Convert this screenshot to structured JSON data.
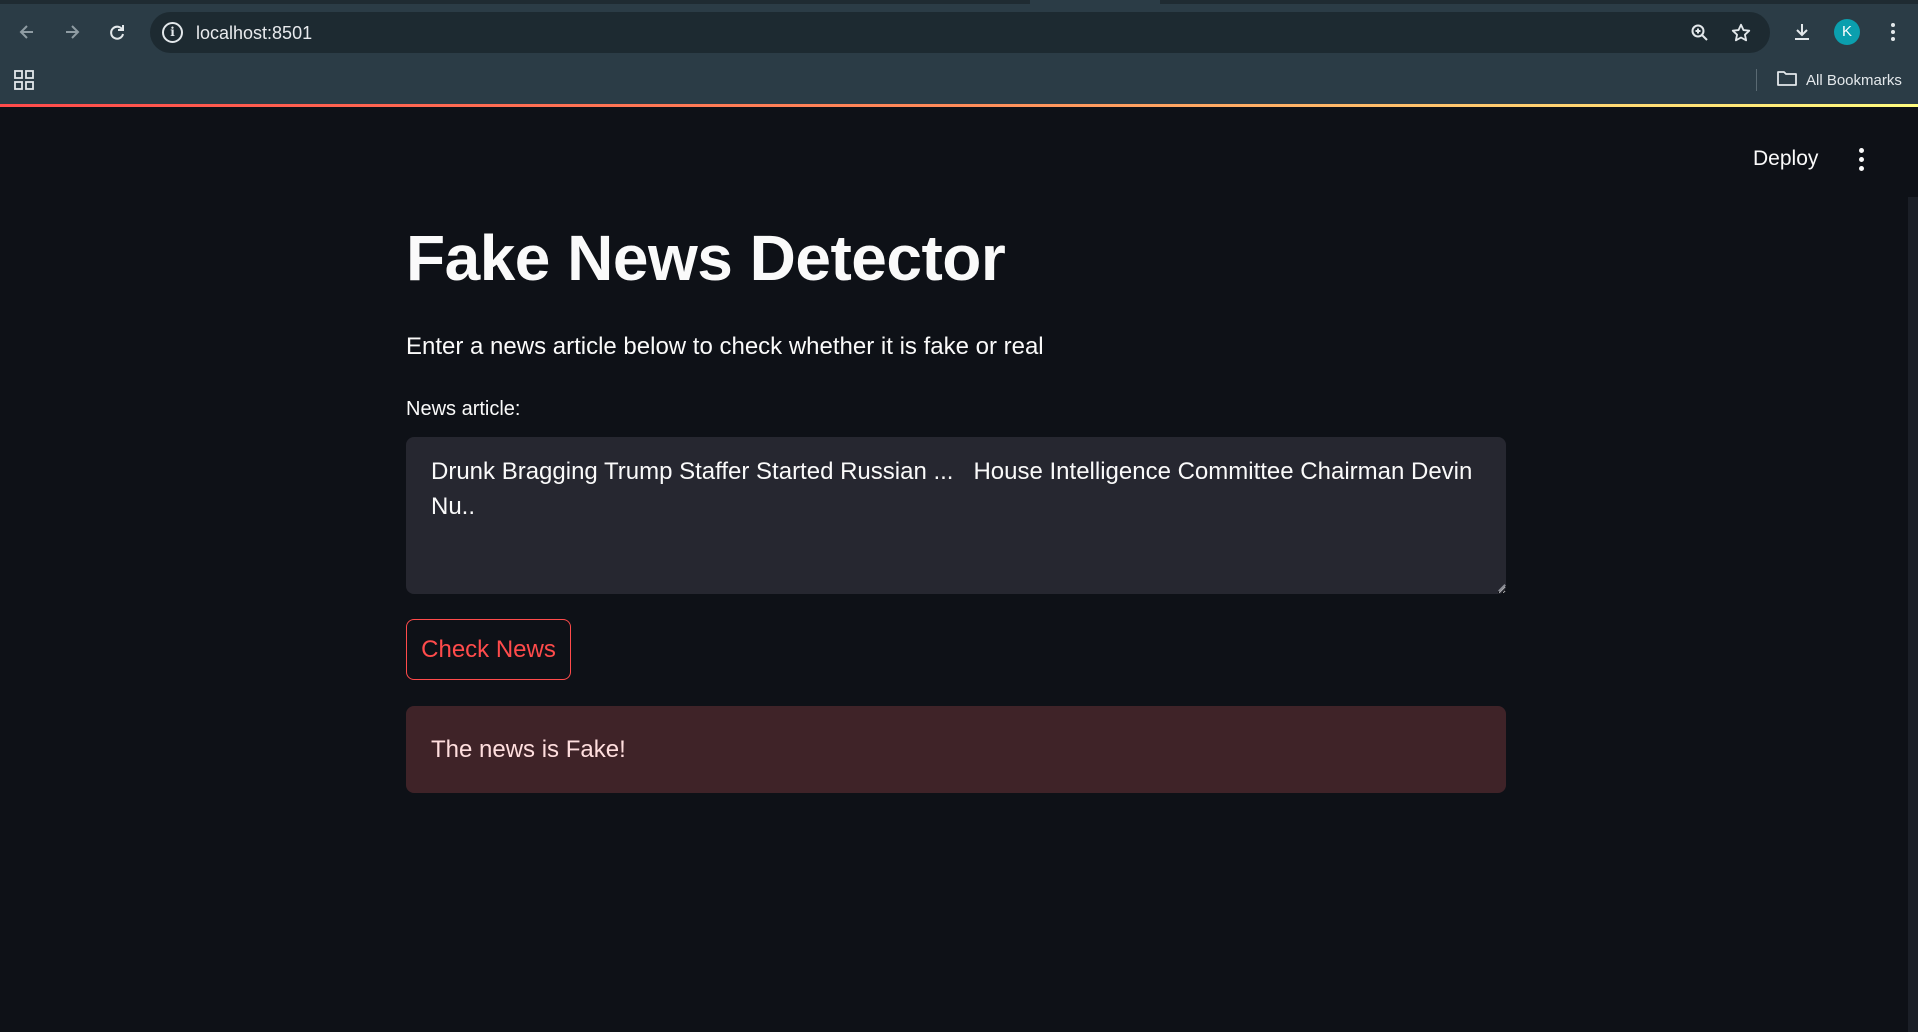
{
  "browser": {
    "url": "localhost:8501",
    "profile_initial": "K",
    "bookmarks_label": "All Bookmarks",
    "icons": [
      "back-icon",
      "forward-icon",
      "reload-icon",
      "site-info-icon",
      "zoom-icon",
      "star-icon",
      "download-icon",
      "menu-icon",
      "apps-icon",
      "folder-icon"
    ]
  },
  "app": {
    "deploy_label": "Deploy",
    "title": "Fake News Detector",
    "subtitle": "Enter a news article below to check whether it is fake or real",
    "input_label": "News article:",
    "input_value": "Drunk Bragging Trump Staffer Started Russian ...   House Intelligence Committee Chairman Devin Nu..",
    "button_label": "Check News",
    "result_text": "The news is Fake!"
  },
  "colors": {
    "background": "#0e1117",
    "primary": "#ff4b4b",
    "error_bg": "#3f2328",
    "input_bg": "#262730"
  }
}
